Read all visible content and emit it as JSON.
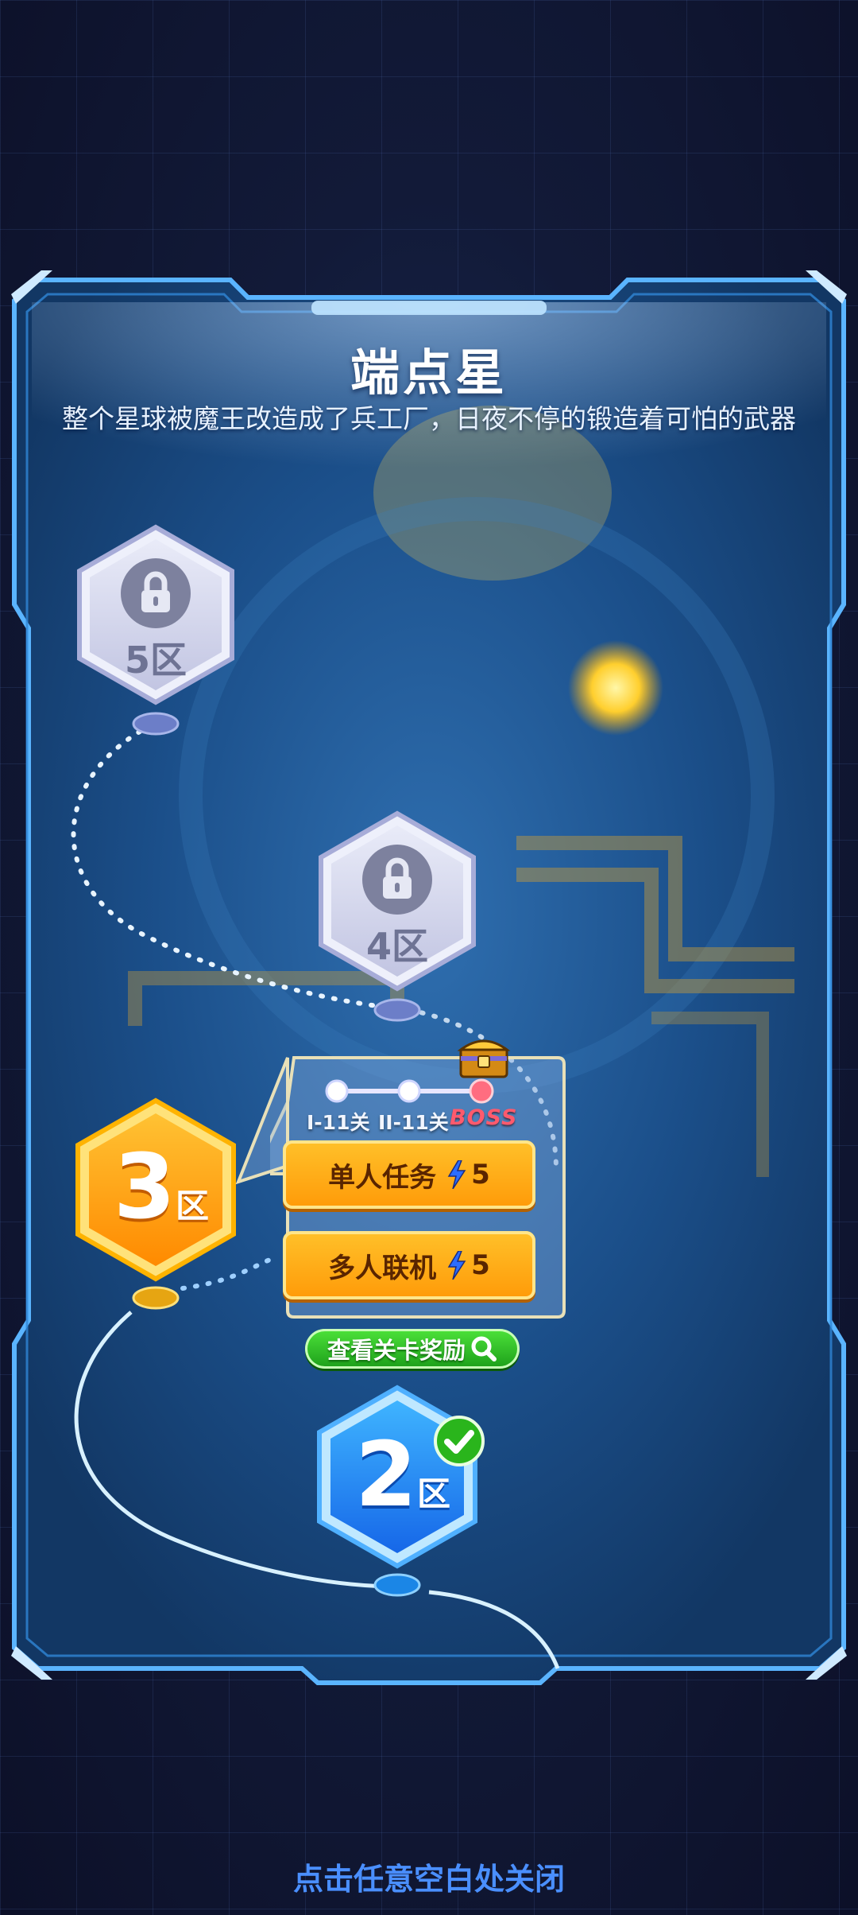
{
  "screen": {
    "title": "端点星",
    "subtitle": "整个星球被魔王改造成了兵工厂，日夜不停的锻造着可怕的武器",
    "close_hint": "点击任意空白处关闭"
  },
  "zones": [
    {
      "id": 5,
      "label": "5区",
      "state": "locked",
      "icon": "lock-icon"
    },
    {
      "id": 4,
      "label": "4区",
      "state": "locked",
      "icon": "lock-icon"
    },
    {
      "id": 3,
      "number": "3",
      "suffix": "区",
      "state": "current"
    },
    {
      "id": 2,
      "number": "2",
      "suffix": "区",
      "state": "completed",
      "icon": "checkmark-icon"
    }
  ],
  "stage_popup": {
    "progress_labels": [
      "I-11关",
      "II-11关",
      "BOSS"
    ],
    "chest_icon": "treasure-chest-icon",
    "solo_button": {
      "label": "单人任务",
      "cost": "5",
      "icon": "lightning-icon"
    },
    "multi_button": {
      "label": "多人联机",
      "cost": "5",
      "icon": "lightning-icon"
    }
  },
  "reward_button": {
    "label": "查看关卡奖励",
    "icon": "magnifier-icon"
  },
  "colors": {
    "accent_blue": "#4a8fff",
    "current_zone_orange": "#ff9a08",
    "completed_zone_blue": "#1f8bff",
    "locked_zone_grey": "#c9cce6",
    "boss_red": "#ff5a6d",
    "reward_green": "#2bbd24"
  }
}
